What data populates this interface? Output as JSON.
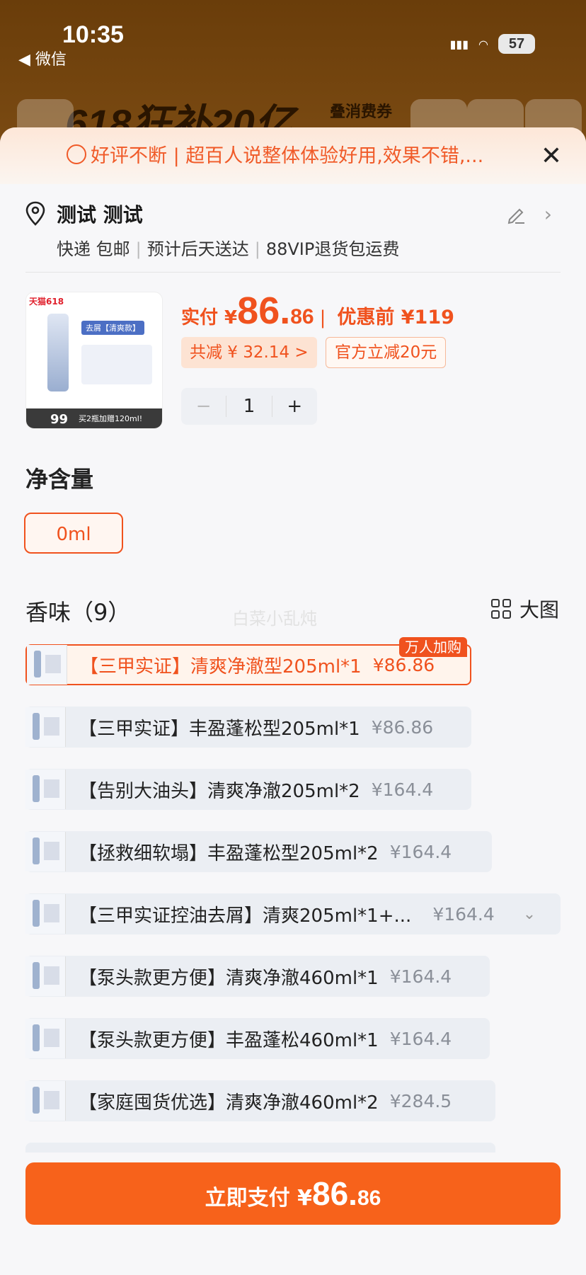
{
  "status": {
    "time": "10:35",
    "back_app": "◀ 微信",
    "battery": "57"
  },
  "backdrop": {
    "title": "618狂补20亿",
    "subtitle": "叠消费券"
  },
  "banner": {
    "text": "好评不断 | 超百人说整体体验好用,效果不错,..."
  },
  "address": {
    "name": "测试 测试",
    "shipping": "快递 包邮",
    "eta": "预计后天送达",
    "service": "88VIP退货包运费"
  },
  "product": {
    "pay_label": "实付 ¥",
    "price_int": "86.",
    "price_dec": "86",
    "before_label": "优惠前 ¥119",
    "discount_chip": "共减 ¥ 32.14 >",
    "official_chip": "官方立减20元",
    "qty": "1",
    "minus": "−",
    "plus": "+",
    "thumb_brand": "天猫618",
    "thumb_tag": "去屑【清爽款】",
    "thumb_promo": "买2瓶加赠120ml!",
    "thumb_price": "99"
  },
  "volume": {
    "title": "净含量",
    "option": "0ml"
  },
  "scent": {
    "title": "香味（9）",
    "bigview": "大图",
    "badge": "万人加购",
    "items": [
      {
        "name": "【三甲实证】清爽净澈型205ml*1",
        "price": "¥86.86"
      },
      {
        "name": "【三甲实证】丰盈蓬松型205ml*1",
        "price": "¥86.86"
      },
      {
        "name": "【告别大油头】清爽净澈205ml*2",
        "price": "¥164.4"
      },
      {
        "name": "【拯救细软塌】丰盈蓬松型205ml*2",
        "price": "¥164.4"
      },
      {
        "name": "【三甲实证控油去屑】清爽205ml*1+...",
        "price": "¥164.4"
      },
      {
        "name": "【泵头款更方便】清爽净澈460ml*1",
        "price": "¥164.4"
      },
      {
        "name": "【泵头款更方便】丰盈蓬松460ml*1",
        "price": "¥164.4"
      },
      {
        "name": "【家庭囤货优选】清爽净澈460ml*2",
        "price": "¥284.5"
      }
    ]
  },
  "watermark": "白菜小乱炖",
  "pay": {
    "label": "立即支付 ¥",
    "int": "86.",
    "dec": "86"
  },
  "colors": {
    "accent": "#f0521e",
    "pay_button": "#f7621b",
    "backdrop": "#6b3d08"
  }
}
